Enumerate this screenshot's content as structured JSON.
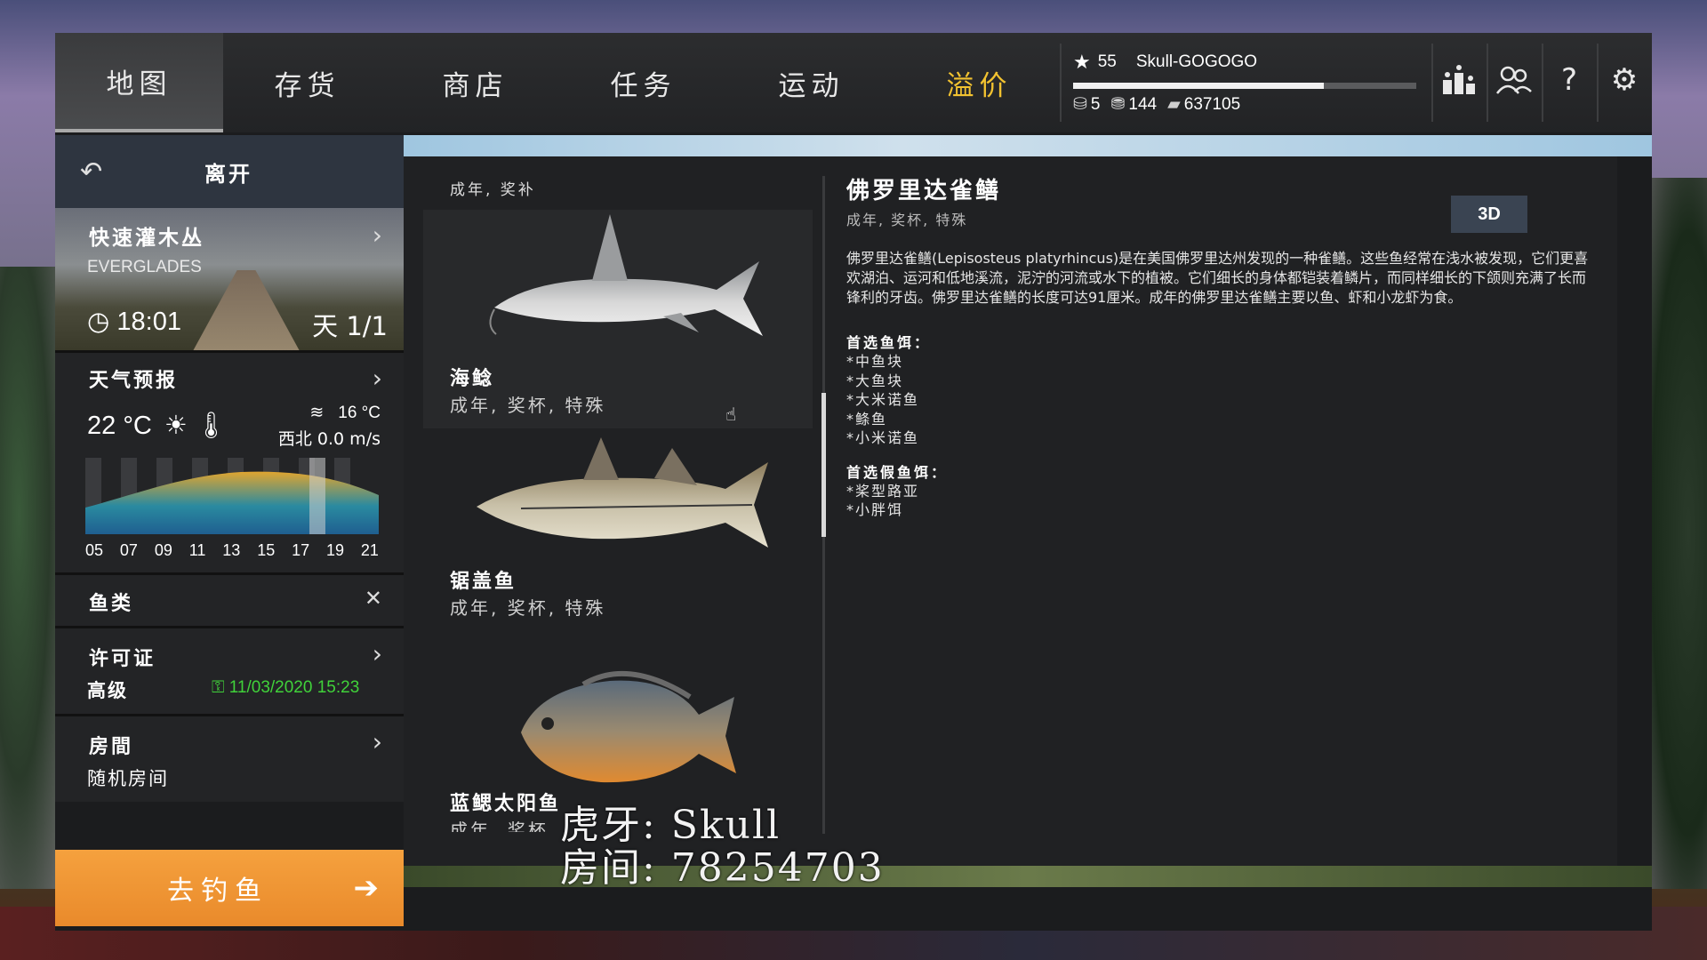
{
  "nav": {
    "tabs": [
      {
        "label": "地图"
      },
      {
        "label": "存货"
      },
      {
        "label": "商店"
      },
      {
        "label": "任务"
      },
      {
        "label": "运动"
      },
      {
        "label": "溢价"
      }
    ]
  },
  "player": {
    "level": "55",
    "name": "Skull-GOGOGO",
    "xp_fraction": 0.73,
    "currency_a": "5",
    "currency_b": "144",
    "currency_c": "637105"
  },
  "sidebar": {
    "leave_label": "离开",
    "location_title": "快速灌木丛",
    "location_sub": "EVERGLADES",
    "time": "18:01",
    "day": "天 1/1",
    "weather_title": "天气预报",
    "air_temp": "22 °C",
    "water_temp": "16 °C",
    "wind": "西北 0.0 m/s",
    "hours": [
      "05",
      "07",
      "09",
      "11",
      "13",
      "15",
      "17",
      "19",
      "21"
    ],
    "fish_title": "鱼类",
    "license_title": "许可证",
    "license_level": "高级",
    "license_expiry": "11/03/2020 15:23",
    "room_title": "房間",
    "room_value": "随机房间",
    "go_fishing": "去钓鱼"
  },
  "fish_list": {
    "header": "成年, 奖补",
    "items": [
      {
        "name": "海鲶",
        "tags": "成年, 奖杯, 特殊"
      },
      {
        "name": "锯盖鱼",
        "tags": "成年, 奖杯, 特殊"
      },
      {
        "name": "蓝鳃太阳鱼",
        "tags": "成年, 奖杯"
      }
    ]
  },
  "detail": {
    "title": "佛罗里达雀鳝",
    "subtitle": "成年, 奖杯, 特殊",
    "btn_3d": "3D",
    "description": "佛罗里达雀鳝(Lepisosteus platyrhincus)是在美国佛罗里达州发现的一种雀鳝。这些鱼经常在浅水被发现，它们更喜欢湖泊、运河和低地溪流，泥泞的河流或水下的植被。它们细长的身体都铠装着鳞片，而同样细长的下颌则充满了长而锋利的牙齿。佛罗里达雀鳝的长度可达91厘米。成年的佛罗里达雀鳝主要以鱼、虾和小龙虾为食。",
    "bait_title": "首选鱼饵：",
    "baits": [
      "*中鱼块",
      "*大鱼块",
      "*大米诺鱼",
      "*鲦鱼",
      "*小米诺鱼"
    ],
    "lure_title": "首选假鱼饵：",
    "lures": [
      "*桨型路亚",
      "*小胖饵"
    ]
  },
  "watermark": {
    "line1": "虎牙: Skull",
    "line2": "房间: 78254703"
  },
  "colors": {
    "accent_gold": "#f2c230",
    "go_orange": "#f09a35",
    "license_green": "#40d23a"
  }
}
